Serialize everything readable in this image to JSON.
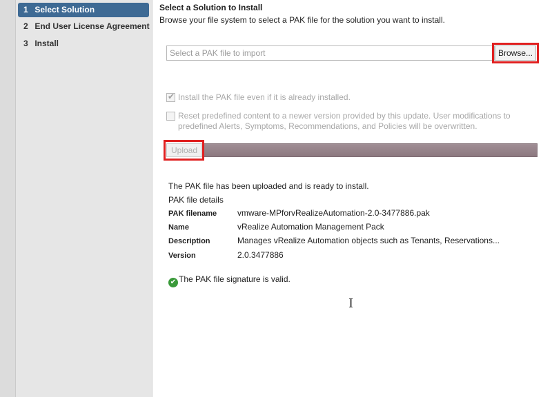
{
  "wizard": {
    "steps": [
      {
        "number": "1",
        "label": "Select Solution",
        "active": true
      },
      {
        "number": "2",
        "label": "End User License Agreement",
        "active": false
      },
      {
        "number": "3",
        "label": "Install",
        "active": false
      }
    ]
  },
  "main": {
    "title": "Select a Solution to Install",
    "subtitle": "Browse your file system to select a PAK file for the solution you want to install.",
    "file_input": {
      "value": "",
      "placeholder": "Select a PAK file to import"
    },
    "browse_label": "Browse...",
    "options": [
      {
        "label": "Install the PAK file even if it is already installed.",
        "checked": true,
        "enabled": false
      },
      {
        "label": "Reset predefined content to a newer version provided by this update. User modifications to predefined Alerts, Symptoms, Recommendations, and Policies will be overwritten.",
        "checked": false,
        "enabled": false
      }
    ],
    "upload_label": "Upload",
    "upload_progress_percent": 100,
    "status_text": "The PAK file has been uploaded and is ready to install.",
    "details_heading": "PAK file details",
    "details": [
      {
        "key": "PAK filename",
        "value": "vmware-MPforvRealizeAutomation-2.0-3477886.pak"
      },
      {
        "key": "Name",
        "value": "vRealize Automation Management Pack"
      },
      {
        "key": "Description",
        "value": "Manages vRealize Automation objects such as Tenants, Reservations..."
      },
      {
        "key": "Version",
        "value": "2.0.3477886"
      }
    ],
    "signature_text": "The PAK file signature is valid.",
    "signature_icon": "check-circle-icon"
  },
  "colors": {
    "active_step": "#3e6a94",
    "highlight": "#e02020",
    "progress": "#8c787f",
    "valid": "#3a9a3a"
  }
}
